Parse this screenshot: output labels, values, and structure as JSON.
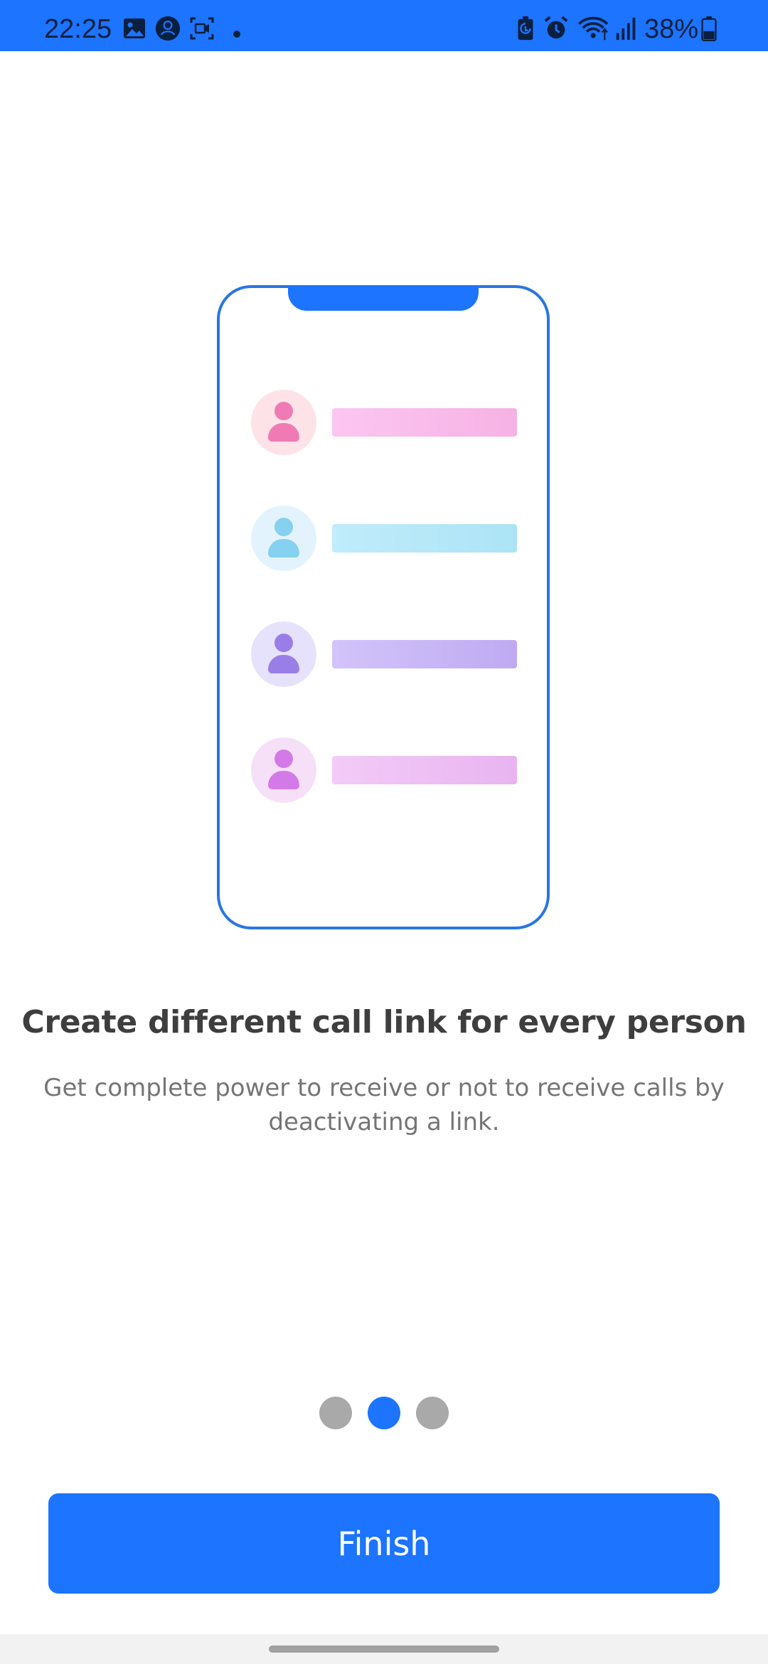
{
  "status_bar": {
    "time": "22:25",
    "battery": "38%",
    "background_color": "#1c74ff",
    "left_icons": [
      "gallery-icon",
      "account-icon",
      "screen-record-icon",
      "notification-dot-icon"
    ],
    "right_icons": [
      "battery-saver-icon",
      "alarm-icon",
      "wifi-icon",
      "signal-icon",
      "battery-icon"
    ]
  },
  "illustration": {
    "frame_color": "#2a75e0",
    "notch_color": "#1c74ff",
    "contacts": [
      {
        "circle": "#fde3e8",
        "figure": "#f07ab4",
        "bar_from": "#fcc6f2",
        "bar_to": "#f6b2e4"
      },
      {
        "circle": "#e2f3fd",
        "figure": "#86d0f0",
        "bar_from": "#c0ecfb",
        "bar_to": "#ace4f6"
      },
      {
        "circle": "#e6e2fb",
        "figure": "#9a7ee8",
        "bar_from": "#d2c4fa",
        "bar_to": "#bfaaf2"
      },
      {
        "circle": "#f6e0f8",
        "figure": "#d47ae8",
        "bar_from": "#f3cbf8",
        "bar_to": "#e8b4f0"
      }
    ]
  },
  "onboarding": {
    "title": "Create different call link for every person",
    "description": "Get complete power to receive or not to receive calls by deactivating a link."
  },
  "pager": {
    "total": 3,
    "active_index": 1,
    "active_color": "#1c74ff",
    "inactive_color": "#a9a9a9"
  },
  "finish_button": {
    "label": "Finish",
    "color": "#1c74ff"
  }
}
